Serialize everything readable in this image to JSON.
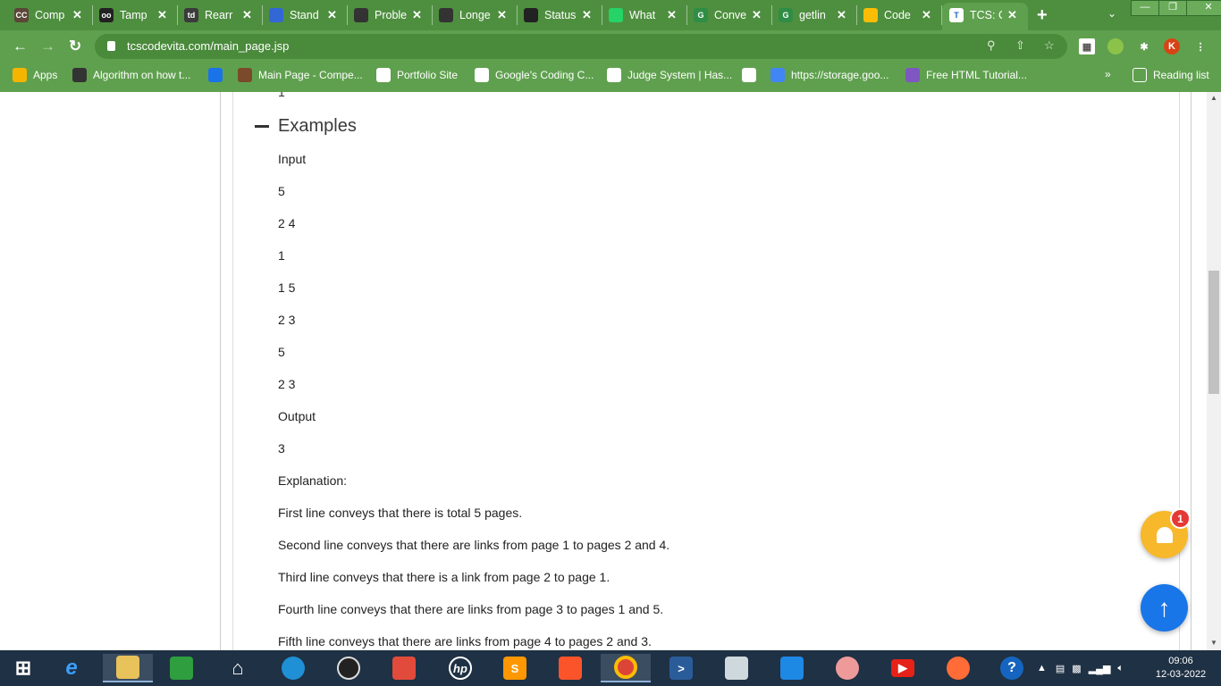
{
  "tabs": [
    {
      "title": "Comp",
      "icon": "codechef-icon",
      "color": "#5b4638",
      "badge": "CC"
    },
    {
      "title": "Tamp",
      "icon": "tampermonkey-icon",
      "color": "#222222",
      "badge": "oo"
    },
    {
      "title": "Rearr",
      "icon": "td-icon",
      "color": "#3b3b3b",
      "badge": "td"
    },
    {
      "title": "Stand",
      "icon": "chart-icon",
      "color": "#3367d6",
      "badge": ""
    },
    {
      "title": "Proble",
      "icon": "leetcode-icon",
      "color": "#333333",
      "badge": ""
    },
    {
      "title": "Longe",
      "icon": "leetcode-icon",
      "color": "#333333",
      "badge": ""
    },
    {
      "title": "Status",
      "icon": "github-icon",
      "color": "#222222",
      "badge": ""
    },
    {
      "title": "What",
      "icon": "whatsapp-icon",
      "color": "#25d366",
      "badge": ""
    },
    {
      "title": "Conve",
      "icon": "gfg-icon",
      "color": "#2f8d46",
      "badge": "G"
    },
    {
      "title": "getlin",
      "icon": "gfg-icon",
      "color": "#2f8d46",
      "badge": "G"
    },
    {
      "title": "Code",
      "icon": "chart-icon",
      "color": "#fbbc05",
      "badge": ""
    },
    {
      "title": "TCS: C",
      "icon": "tcs-icon",
      "color": "#ffffff",
      "badge": "T"
    }
  ],
  "url": "tcscodevita.com/main_page.jsp",
  "profile_initial": "K",
  "bookmarks": [
    {
      "label": "Apps"
    },
    {
      "label": "Algorithm on how t..."
    },
    {
      "label": ""
    },
    {
      "label": "Main Page - Compe..."
    },
    {
      "label": "Portfolio Site"
    },
    {
      "label": "Google's Coding C..."
    },
    {
      "label": "Judge System | Has..."
    },
    {
      "label": ""
    },
    {
      "label": "https://storage.goo..."
    },
    {
      "label": "Free HTML Tutorial..."
    }
  ],
  "bookmarks_more": "»",
  "reading_list": "Reading list",
  "content": {
    "prev_text": "1",
    "section_title": "Examples",
    "lines": [
      "Input",
      "5",
      "2 4",
      "1",
      "1 5",
      "2 3",
      "5",
      "2 3",
      "Output",
      "3",
      "Explanation:",
      "First line conveys that there is total 5 pages.",
      "Second line conveys that there are links from page 1 to pages 2 and 4.",
      "Third line conveys that there is a link from page 2 to page 1.",
      "Fourth line conveys that there are links from page 3 to pages 1 and 5.",
      "Fifth line conveys that there are links from page 4 to pages 2 and 3."
    ]
  },
  "notification_count": "1",
  "clock": {
    "time": "09:06",
    "date": "12-03-2022"
  }
}
